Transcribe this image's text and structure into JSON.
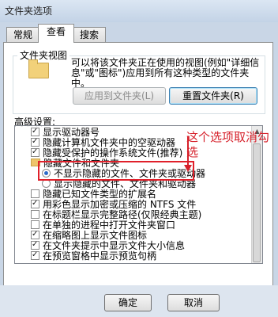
{
  "window": {
    "title": "文件夹选项"
  },
  "tabs": [
    {
      "label": "常规"
    },
    {
      "label": "查看"
    },
    {
      "label": "搜索"
    }
  ],
  "folder_views": {
    "group_title": "文件夹视图",
    "description": "可以将该文件夹正在使用的视图(例如\"详细信息\"或\"图标\")应用到所有这种类型的文件夹中。",
    "apply_button": "应用到文件夹(L)",
    "reset_button": "重置文件夹(R)"
  },
  "advanced": {
    "label": "高级设置:",
    "items": [
      {
        "type": "checkbox",
        "checked": true,
        "label": "显示驱动器号"
      },
      {
        "type": "checkbox",
        "checked": true,
        "label": "隐藏计算机文件夹中的空驱动器"
      },
      {
        "type": "checkbox",
        "checked": true,
        "label": "隐藏受保护的操作系统文件(推荐)"
      },
      {
        "type": "folder",
        "label": "隐藏文件和文件夹"
      },
      {
        "type": "radio",
        "checked": true,
        "label": "不显示隐藏的文件、文件夹或驱动器"
      },
      {
        "type": "radio",
        "checked": false,
        "label": "显示隐藏的文件、文件夹和驱动器"
      },
      {
        "type": "checkbox",
        "checked": false,
        "label": "隐藏已知文件类型的扩展名"
      },
      {
        "type": "checkbox",
        "checked": true,
        "label": "用彩色显示加密或压缩的 NTFS 文件"
      },
      {
        "type": "checkbox",
        "checked": false,
        "label": "在标题栏显示完整路径(仅限经典主题)"
      },
      {
        "type": "checkbox",
        "checked": false,
        "label": "在单独的进程中打开文件夹窗口"
      },
      {
        "type": "checkbox",
        "checked": true,
        "label": "在缩略图上显示文件图标"
      },
      {
        "type": "checkbox",
        "checked": true,
        "label": "在文件夹提示中显示文件大小信息"
      },
      {
        "type": "checkbox",
        "checked": true,
        "label": "在预览窗格中显示预览句柄"
      }
    ]
  },
  "annotation": {
    "text": "这个选项取消勾选",
    "color": "#d6202a"
  },
  "buttons": {
    "ok": "确定",
    "cancel": "取消"
  }
}
